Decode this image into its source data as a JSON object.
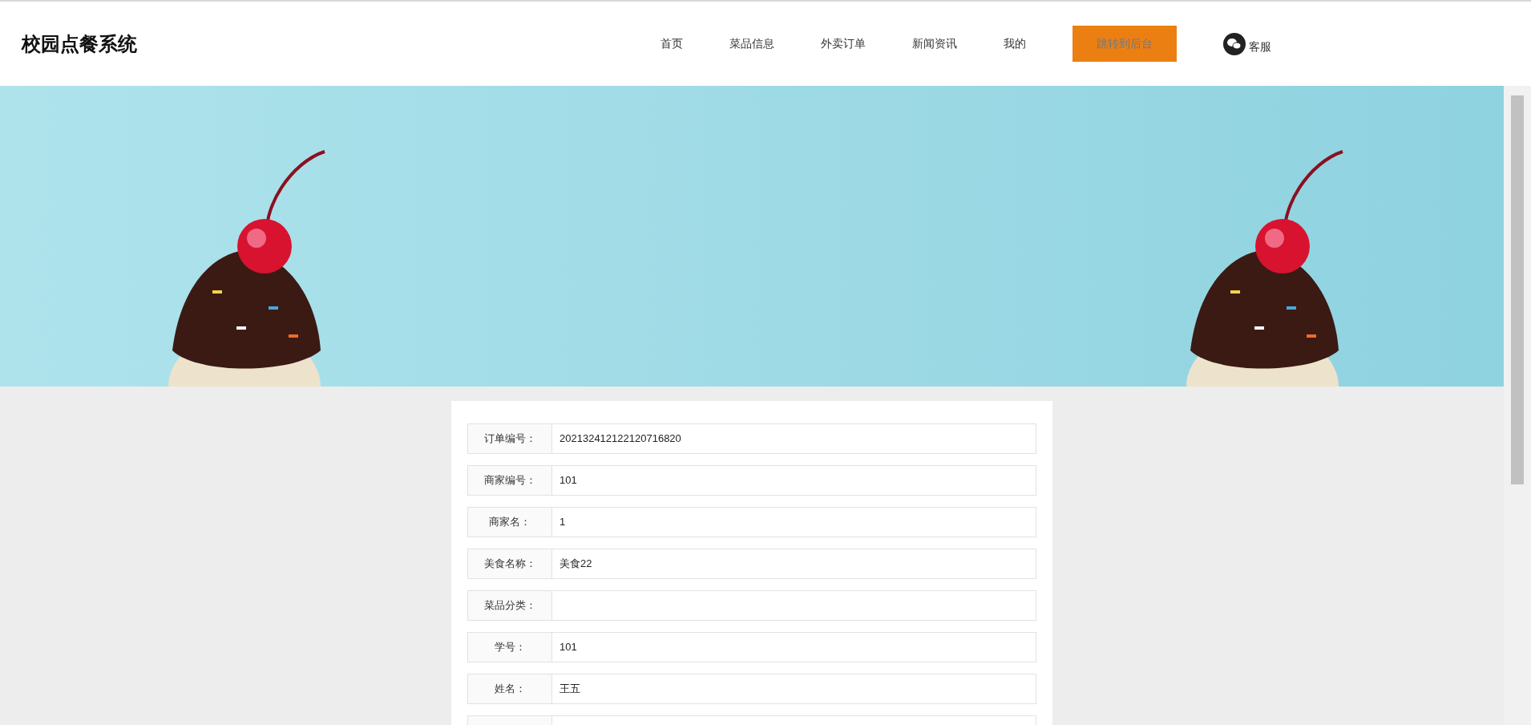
{
  "header": {
    "title": "校园点餐系统",
    "nav": [
      {
        "label": "首页",
        "kind": "link"
      },
      {
        "label": "菜品信息",
        "kind": "link"
      },
      {
        "label": "外卖订单",
        "kind": "link"
      },
      {
        "label": "新闻资讯",
        "kind": "link"
      },
      {
        "label": "我的",
        "kind": "link"
      },
      {
        "label": "跳转到后台",
        "kind": "button"
      },
      {
        "label": "客服",
        "kind": "service"
      }
    ]
  },
  "form": {
    "fields": [
      {
        "label": "订单编号：",
        "value": "202132412122120716820"
      },
      {
        "label": "商家编号：",
        "value": "101"
      },
      {
        "label": "商家名：",
        "value": "1"
      },
      {
        "label": "美食名称：",
        "value": "美食22"
      },
      {
        "label": "菜品分类："
      },
      {
        "label": "学号：",
        "value": "101"
      },
      {
        "label": "姓名：",
        "value": "王五"
      }
    ],
    "more_rows_below": true
  }
}
